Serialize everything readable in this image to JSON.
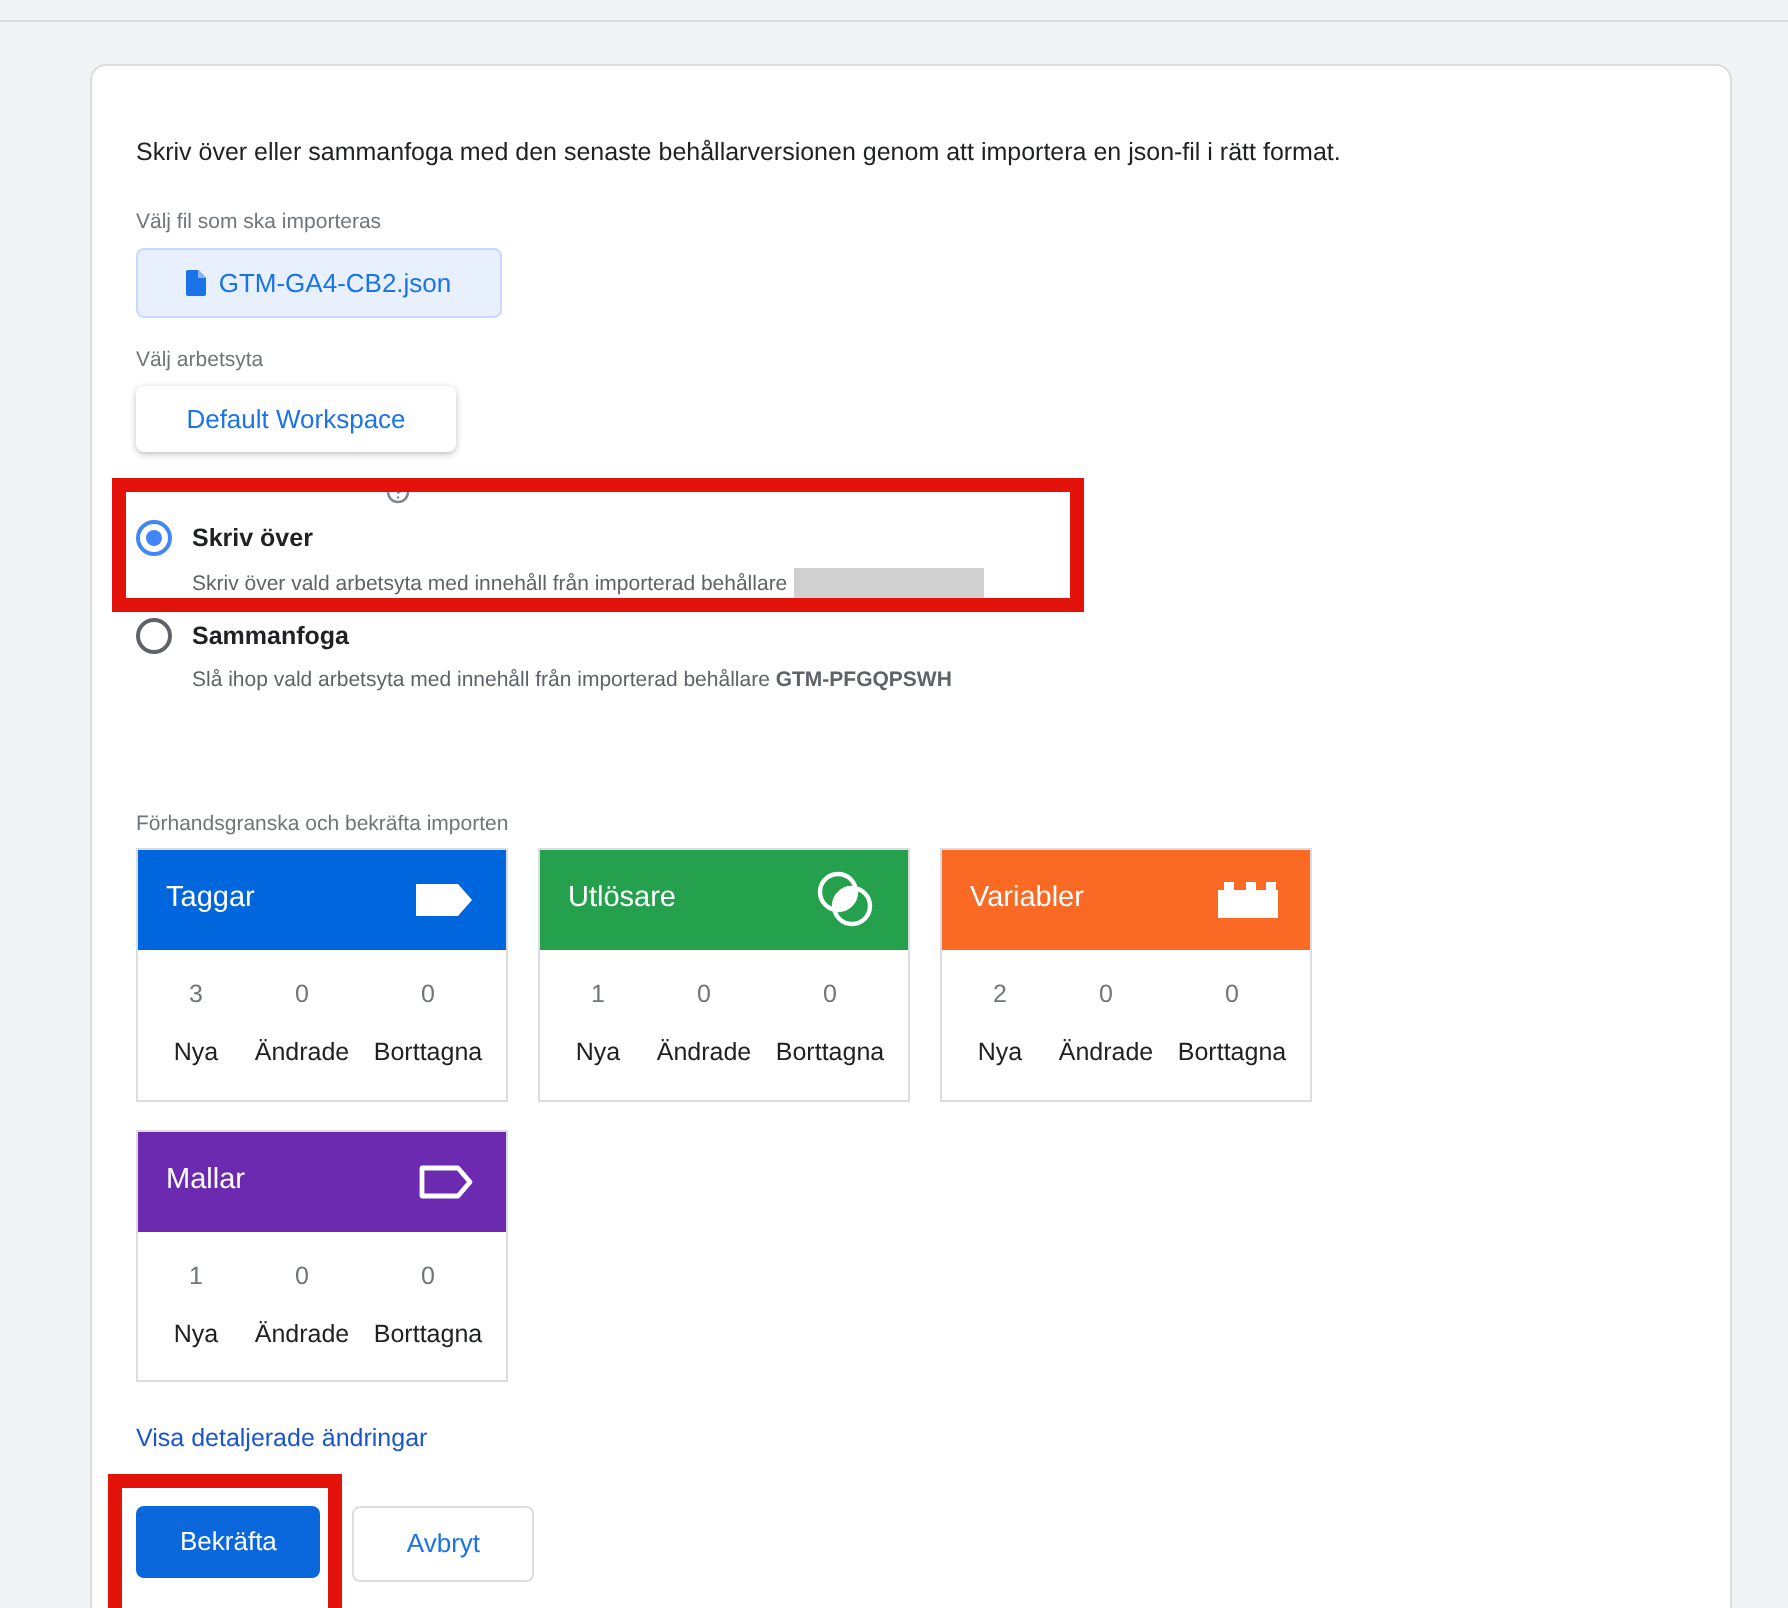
{
  "intro": "Skriv över eller sammanfoga med den senaste behållarversionen genom att importera en json-fil i rätt format.",
  "file_label": "Välj fil som ska importeras",
  "file_button": "GTM-GA4-CB2.json",
  "workspace_label": "Välj arbetsyta",
  "workspace_button": "Default Workspace",
  "options": [
    {
      "title": "Skriv över",
      "description": "Skriv över vald arbetsyta med innehåll från importerad behållare",
      "redacted": true,
      "selected": true,
      "highlighted": true
    },
    {
      "title": "Sammanfoga",
      "description": "Slå ihop vald arbetsyta med innehåll från importerad behållare **GTM-PFGQPSWH**",
      "redacted": false,
      "selected": false,
      "highlighted": false
    }
  ],
  "preview_label": "Förhandsgranska och bekräfta importen",
  "tiles": [
    {
      "kind": "tags",
      "title": "Taggar",
      "color": "#0066dd",
      "stats": [
        {
          "value": "3",
          "label": "Nya"
        },
        {
          "value": "0",
          "label": "Ändrade"
        },
        {
          "value": "0",
          "label": "Borttagna"
        }
      ]
    },
    {
      "kind": "triggers",
      "title": "Utlösare",
      "color": "#25a04d",
      "stats": [
        {
          "value": "1",
          "label": "Nya"
        },
        {
          "value": "0",
          "label": "Ändrade"
        },
        {
          "value": "0",
          "label": "Borttagna"
        }
      ]
    },
    {
      "kind": "variables",
      "title": "Variabler",
      "color": "#fa6a24",
      "stats": [
        {
          "value": "2",
          "label": "Nya"
        },
        {
          "value": "0",
          "label": "Ändrade"
        },
        {
          "value": "0",
          "label": "Borttagna"
        }
      ]
    },
    {
      "kind": "templates",
      "title": "Mallar",
      "color": "#6b2aaf",
      "stats": [
        {
          "value": "1",
          "label": "Nya"
        },
        {
          "value": "0",
          "label": "Ändrade"
        },
        {
          "value": "0",
          "label": "Borttagna"
        }
      ]
    }
  ],
  "details_link": "Visa detaljerade ändringar",
  "buttons": [
    {
      "label": "Bekräfta",
      "kind": "primary",
      "highlighted": true
    },
    {
      "label": "Avbryt",
      "kind": "secondary",
      "highlighted": false
    }
  ]
}
